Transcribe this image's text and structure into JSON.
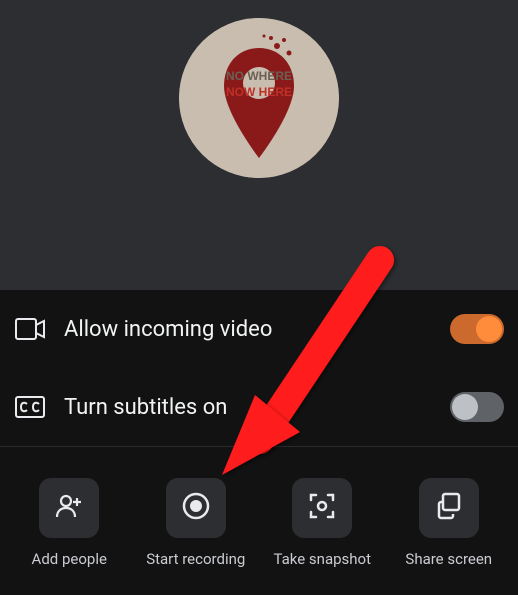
{
  "avatar": {
    "text_top": "NO WHERE",
    "text_bottom": "NOW HERE"
  },
  "options": [
    {
      "id": "allow-video",
      "label": "Allow incoming video",
      "icon": "video-icon",
      "enabled": true
    },
    {
      "id": "subtitles",
      "label": "Turn subtitles on",
      "icon": "cc-icon",
      "enabled": false
    }
  ],
  "actions": [
    {
      "id": "add-people",
      "label": "Add people",
      "icon": "person-add-icon"
    },
    {
      "id": "start-recording",
      "label": "Start recording",
      "icon": "record-icon"
    },
    {
      "id": "take-snapshot",
      "label": "Take snapshot",
      "icon": "snapshot-icon"
    },
    {
      "id": "share-screen",
      "label": "Share screen",
      "icon": "share-screen-icon"
    }
  ],
  "colors": {
    "accent": "#ff8c3a",
    "bg_dark": "#121212",
    "bg_video": "#2d2e31"
  }
}
